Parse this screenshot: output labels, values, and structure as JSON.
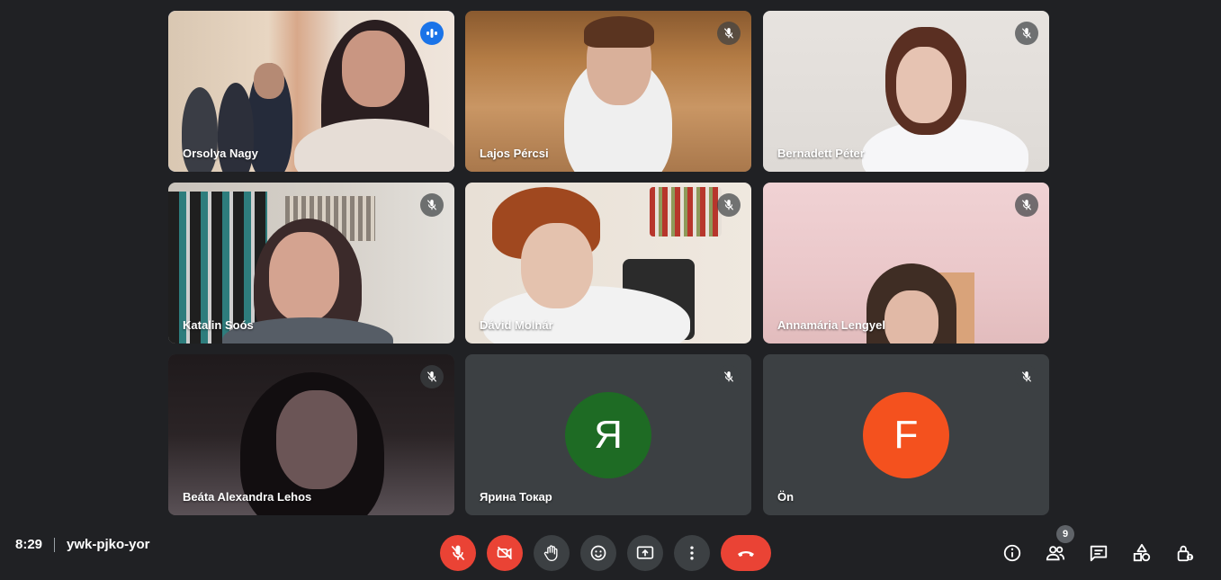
{
  "meeting": {
    "time": "8:29",
    "code": "ywk-pjko-yor"
  },
  "participants_count": "9",
  "tiles": [
    {
      "name": "Orsolya Nagy",
      "speaking": true
    },
    {
      "name": "Lajos Pércsi"
    },
    {
      "name": "Bernadett Péter"
    },
    {
      "name": "Katalin Soós"
    },
    {
      "name": "Dávid Molnár"
    },
    {
      "name": "Annamária Lengyel"
    },
    {
      "name": "Beáta Alexandra Lehos"
    },
    {
      "name": "Ярина Токар",
      "avatar_letter": "Я",
      "avatar_color": "#1e6b24"
    },
    {
      "name": "Ön",
      "avatar_letter": "F",
      "avatar_color": "#f4511e"
    }
  ],
  "controls": {
    "mic": "mic-off-icon",
    "camera": "camera-off-icon",
    "hand": "raise-hand-icon",
    "emoji": "emoji-icon",
    "present": "present-icon",
    "more": "more-vert-icon",
    "end": "end-call-icon"
  },
  "right_icons": [
    "info-icon",
    "people-icon",
    "chat-icon",
    "activities-icon",
    "host-controls-icon"
  ]
}
